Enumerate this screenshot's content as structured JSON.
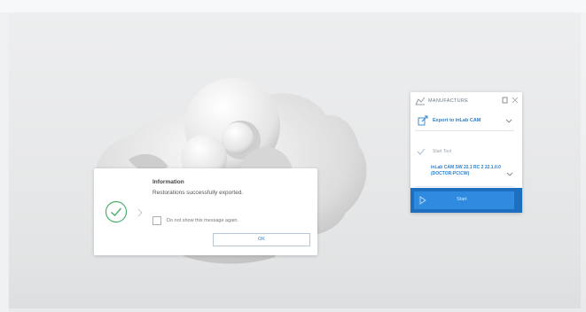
{
  "info_dialog": {
    "title": "Information",
    "message": "Restorations successfully exported.",
    "dont_show_label": "Do not show this message again.",
    "ok_label": "OK",
    "checked": false
  },
  "manufacture_panel": {
    "title": "MANUFACTURE",
    "export_label": "Export to inLab CAM",
    "start_tool_label": "Start Tool",
    "device_label": "inLab CAM SW 22.1 RC 2 22.1.0.0 (DOCTOR-PC\\CW)",
    "start_label": "Start",
    "accent_color": "#2f80c8",
    "footer_color": "#1f6fc1"
  },
  "icons": {
    "success": "check-circle-icon",
    "pin": "pin-icon",
    "close": "close-icon",
    "export": "export-icon",
    "start": "play-icon"
  }
}
